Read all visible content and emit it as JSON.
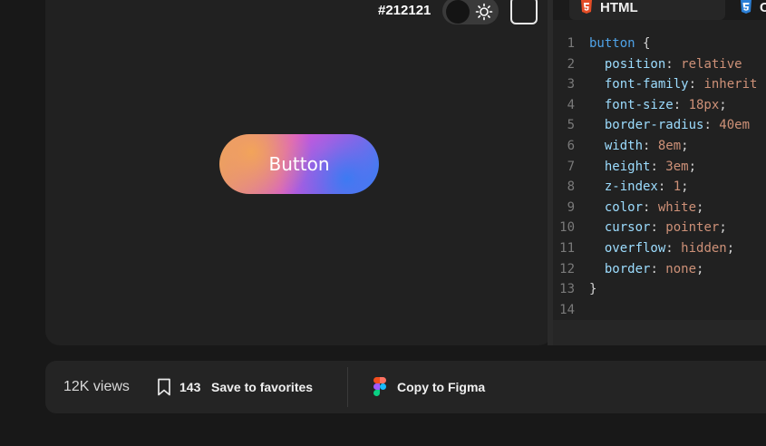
{
  "preview": {
    "background_hex_label": "#212121",
    "button_label": "Button",
    "theme": "dark"
  },
  "editor": {
    "tabs": [
      {
        "label": "HTML",
        "icon": "html5-icon"
      },
      {
        "label": "C",
        "icon": "css3-icon"
      }
    ],
    "lines": [
      {
        "n": "1",
        "parts": [
          {
            "t": "button",
            "c": "sel"
          },
          {
            "t": " {",
            "c": "code-text"
          }
        ]
      },
      {
        "n": "2",
        "parts": [
          {
            "t": "  position",
            "c": "prop"
          },
          {
            "t": ": ",
            "c": "code-text"
          },
          {
            "t": "relative",
            "c": "val"
          }
        ]
      },
      {
        "n": "3",
        "parts": [
          {
            "t": "  font-family",
            "c": "prop"
          },
          {
            "t": ": ",
            "c": "code-text"
          },
          {
            "t": "inherit",
            "c": "val"
          }
        ]
      },
      {
        "n": "4",
        "parts": [
          {
            "t": "  font-size",
            "c": "prop"
          },
          {
            "t": ": ",
            "c": "code-text"
          },
          {
            "t": "18px",
            "c": "val"
          },
          {
            "t": ";",
            "c": "code-text"
          }
        ]
      },
      {
        "n": "5",
        "parts": [
          {
            "t": "  border-radius",
            "c": "prop"
          },
          {
            "t": ": ",
            "c": "code-text"
          },
          {
            "t": "40em",
            "c": "val"
          }
        ]
      },
      {
        "n": "6",
        "parts": [
          {
            "t": "  width",
            "c": "prop"
          },
          {
            "t": ": ",
            "c": "code-text"
          },
          {
            "t": "8em",
            "c": "val"
          },
          {
            "t": ";",
            "c": "code-text"
          }
        ]
      },
      {
        "n": "7",
        "parts": [
          {
            "t": "  height",
            "c": "prop"
          },
          {
            "t": ": ",
            "c": "code-text"
          },
          {
            "t": "3em",
            "c": "val"
          },
          {
            "t": ";",
            "c": "code-text"
          }
        ]
      },
      {
        "n": "8",
        "parts": [
          {
            "t": "  z-index",
            "c": "prop"
          },
          {
            "t": ": ",
            "c": "code-text"
          },
          {
            "t": "1",
            "c": "val"
          },
          {
            "t": ";",
            "c": "code-text"
          }
        ]
      },
      {
        "n": "9",
        "parts": [
          {
            "t": "  color",
            "c": "prop"
          },
          {
            "t": ": ",
            "c": "code-text"
          },
          {
            "t": "white",
            "c": "val"
          },
          {
            "t": ";",
            "c": "code-text"
          }
        ]
      },
      {
        "n": "10",
        "parts": [
          {
            "t": "  cursor",
            "c": "prop"
          },
          {
            "t": ": ",
            "c": "code-text"
          },
          {
            "t": "pointer",
            "c": "val"
          },
          {
            "t": ";",
            "c": "code-text"
          }
        ]
      },
      {
        "n": "11",
        "parts": [
          {
            "t": "  overflow",
            "c": "prop"
          },
          {
            "t": ": ",
            "c": "code-text"
          },
          {
            "t": "hidden",
            "c": "val"
          },
          {
            "t": ";",
            "c": "code-text"
          }
        ]
      },
      {
        "n": "12",
        "parts": [
          {
            "t": "  border",
            "c": "prop"
          },
          {
            "t": ": ",
            "c": "code-text"
          },
          {
            "t": "none",
            "c": "val"
          },
          {
            "t": ";",
            "c": "code-text"
          }
        ]
      },
      {
        "n": "13",
        "parts": [
          {
            "t": "}",
            "c": "code-text"
          }
        ]
      },
      {
        "n": "14",
        "parts": []
      }
    ]
  },
  "footer": {
    "views": "12K views",
    "favorites_count": "143",
    "favorites_label": "Save to favorites",
    "figma_label": "Copy to Figma"
  },
  "colors": {
    "page_bg": "#181818",
    "panel_bg": "#212121",
    "selector": "#4fa3e8",
    "property": "#9cdcfe",
    "value": "#ce9178"
  }
}
